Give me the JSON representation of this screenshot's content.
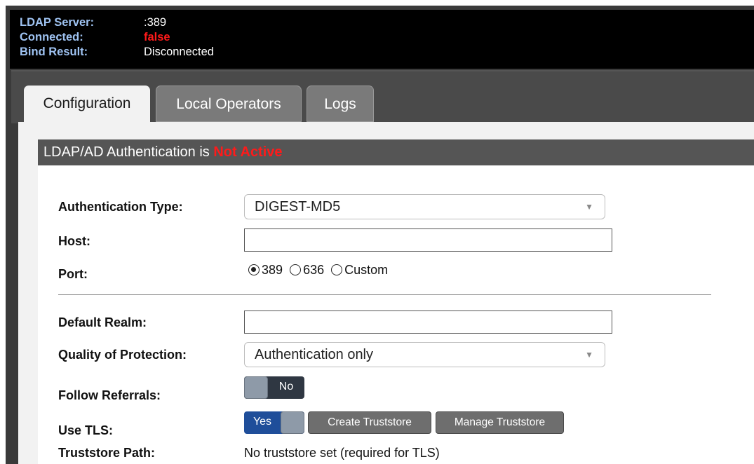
{
  "status": {
    "server_label": "LDAP Server:",
    "server_value": ":389",
    "connected_label": "Connected:",
    "connected_value": "false",
    "bind_label": "Bind Result:",
    "bind_value": "Disconnected"
  },
  "tabs": [
    {
      "label": "Configuration",
      "active": true
    },
    {
      "label": "Local Operators",
      "active": false
    },
    {
      "label": "Logs",
      "active": false
    }
  ],
  "section": {
    "prefix": "LDAP/AD Authentication is",
    "state": "Not Active"
  },
  "form": {
    "auth_type_label": "Authentication Type:",
    "auth_type_value": "DIGEST-MD5",
    "host_label": "Host:",
    "host_value": "",
    "port_label": "Port:",
    "port_options": [
      "389",
      "636",
      "Custom"
    ],
    "port_selected": "389",
    "realm_label": "Default Realm:",
    "realm_value": "",
    "qop_label": "Quality of Protection:",
    "qop_value": "Authentication only",
    "referrals_label": "Follow Referrals:",
    "referrals_value": "No",
    "tls_label": "Use TLS:",
    "tls_value": "Yes",
    "create_truststore": "Create Truststore",
    "manage_truststore": "Manage Truststore",
    "truststore_label": "Truststore Path:",
    "truststore_value": "No truststore set (required for TLS)"
  },
  "colors": {
    "alert": "#ff1a1a",
    "header_label": "#9fc3f2",
    "toggle_yes": "#1f4e9a"
  },
  "icons": {
    "dropdown": "chevron-down-icon",
    "radio": "radio-icon"
  }
}
